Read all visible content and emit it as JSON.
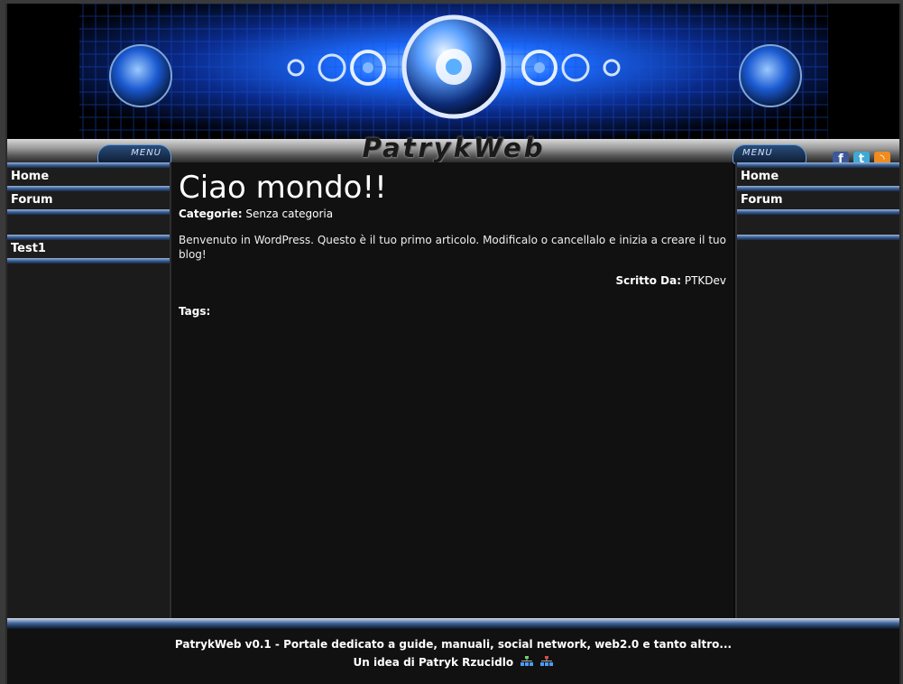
{
  "header": {
    "logo_text": "PatrykWeb",
    "menu_tab_label": "MENU"
  },
  "sidebar_left": {
    "items": [
      {
        "label": "Home"
      },
      {
        "label": "Forum"
      },
      {
        "label": ""
      },
      {
        "label": "Test1"
      }
    ]
  },
  "sidebar_right": {
    "items": [
      {
        "label": "Home"
      },
      {
        "label": "Forum"
      },
      {
        "label": ""
      }
    ]
  },
  "social": {
    "icons": [
      "facebook-icon",
      "twitter-icon",
      "rss-icon"
    ],
    "facebook_glyph": "f",
    "twitter_glyph": "t",
    "rss_glyph": "◝"
  },
  "post": {
    "title": "Ciao mondo!!",
    "category_label": "Categorie:",
    "category_value": "Senza categoria",
    "excerpt": "Benvenuto in WordPress. Questo è il tuo primo articolo. Modificalo o cancellalo e inizia a creare il tuo blog!",
    "author_label": "Scritto Da:",
    "author_value": "PTKDev",
    "tags_label": "Tags:"
  },
  "footer": {
    "line1": "PatrykWeb v0.1 - Portale dedicato a guide, manuali, social network, web2.0 e tanto altro...",
    "line2": "Un idea di Patryk Rzucidlo"
  },
  "colors": {
    "accent_blue": "#3a5f95",
    "background": "#111111",
    "sidebar": "#1b1b1b"
  }
}
